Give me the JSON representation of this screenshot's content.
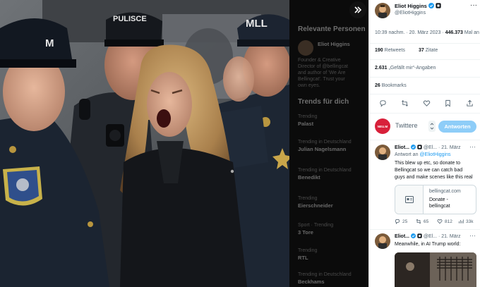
{
  "viewer": {
    "expand_icon": "double-chevron-right-icon",
    "photo_text": {
      "cap_left": "M",
      "cap_center": "PULISCE",
      "cap_right": "MLL"
    },
    "bg_page": {
      "section_people": "Relevante Personen",
      "person_name": "Eliot Higgins",
      "person_lines": [
        "Founder & Creative",
        "Director of @bellingcat",
        "and author of 'We Are",
        "Bellingcat'. Trust your",
        "own eyes."
      ],
      "section_trends": "Trends für dich",
      "trends": [
        {
          "meta": "Trending",
          "label": "Palast"
        },
        {
          "meta": "Trending in Deutschland",
          "label": "Julian Nagelsmann"
        },
        {
          "meta": "Trending in Deutschland",
          "label": "Benedikt"
        },
        {
          "meta": "Trending",
          "label": "Eierschneider"
        },
        {
          "meta": "Sport · Trending",
          "label": "3 Tore"
        },
        {
          "meta": "Trending",
          "label": "RTL"
        },
        {
          "meta": "Trending in Deutschland",
          "label": "Beckhams"
        }
      ]
    }
  },
  "tweet": {
    "author_name": "Eliot Higgins",
    "author_handle": "@EliotHiggins",
    "time": "10:39 nachm. · 20. März 2023 ·",
    "views": "446.373",
    "views_suffix": "Mal an",
    "retweets_count": "190",
    "retweets_label": "Retweets",
    "quotes_count": "37",
    "quotes_label": "Zitate",
    "likes_count": "2.631",
    "likes_label": "„Gefällt mir“-Angaben",
    "bookmarks_count": "26",
    "bookmarks_label": "Bookmarks"
  },
  "compose": {
    "avatar_label": "NEU.M",
    "placeholder": "Twittere",
    "submit_label": "Antworten"
  },
  "replies": [
    {
      "name": "Eliot...",
      "handle": "@El...",
      "date": "· 21. März",
      "reply_to_prefix": "Antwort an",
      "reply_to": "@EliotHiggins",
      "text_lines": [
        "This blew up etc, so donate to",
        "Bellingcat so we can catch bad",
        "guys and make scenes like this real"
      ],
      "card_domain": "bellingcat.com",
      "card_title_lines": [
        "Donate -",
        "bellingcat"
      ],
      "replies_count": "25",
      "retweets_count": "65",
      "likes_count": "812",
      "views_count": "33k"
    },
    {
      "name": "Eliot...",
      "handle": "@El...",
      "date": "· 21. März",
      "text_lines": [
        "Meanwhile, in AI Trump world:"
      ]
    }
  ],
  "colors": {
    "accent": "#1d9bf0",
    "accent_disabled": "#8ecdf8",
    "verified": "#1d9bf0",
    "compose_avatar": "#d8203a"
  }
}
